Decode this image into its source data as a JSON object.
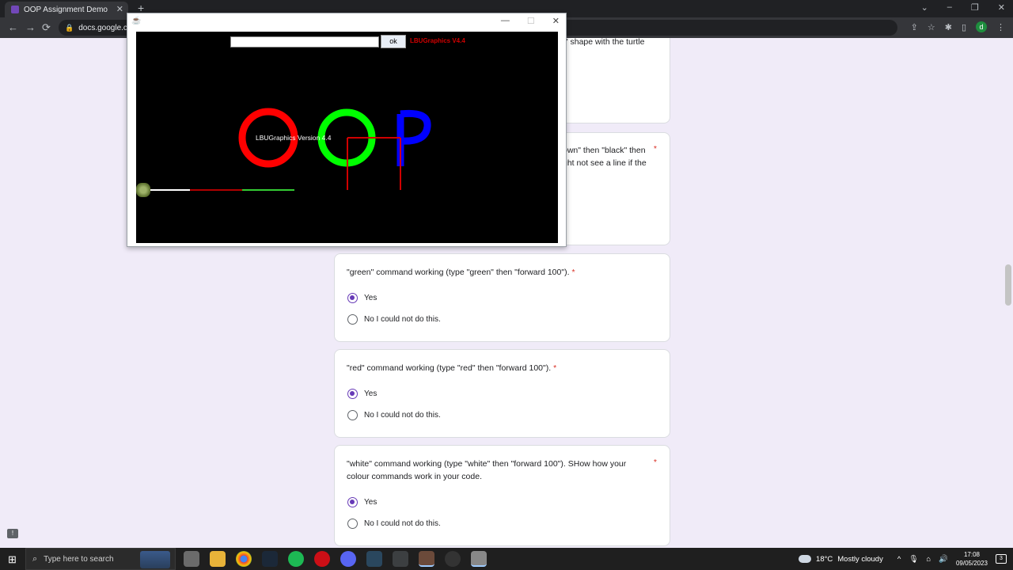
{
  "browser": {
    "tab_title": "OOP Assignment Demo",
    "tab_close": "✕",
    "new_tab": "+",
    "url": "docs.google.com",
    "lock": "🔒",
    "back": "←",
    "forward": "→",
    "reload": "⟳",
    "window_min": "⌄",
    "window_minimize": "–",
    "window_restore": "❐",
    "window_close": "✕",
    "profile_initial": "d",
    "toolbar_icons": [
      "share-icon",
      "star-icon",
      "extensions-icon",
      "sidepanel-icon"
    ]
  },
  "form": {
    "partial_top_text": "h\" shape with the turtle",
    "partial_mid_text_1": "own\" then \"black\" then",
    "partial_mid_text_2": "ght not see a line if the",
    "required_marker": "*",
    "questions": [
      {
        "title": "\"green\" command working (type \"green\" then \"forward 100\").",
        "options": [
          "Yes",
          "No I could not do this."
        ],
        "selected": 0
      },
      {
        "title": "\"red\" command working (type \"red\" then \"forward 100\").",
        "options": [
          "Yes",
          "No I could not do this."
        ],
        "selected": 0
      },
      {
        "title_line1": "\"white\" command working (type \"white\" then \"forward 100\"). SHow how your",
        "title_line2": "colour commands work in your code.",
        "options": [
          "Yes",
          "No I could not do this."
        ],
        "selected": 0
      }
    ],
    "feedback_icon": "!"
  },
  "java_window": {
    "title_icon": "java-cup-icon",
    "minimize": "—",
    "maximize": "☐",
    "close": "✕",
    "command_input_value": "",
    "ok_button": "ok",
    "version_label": "LBUGraphics V4.4",
    "canvas_label": "LBUGraphics Version 4.4",
    "colors": {
      "red": "#ff0000",
      "green": "#00ff00",
      "blue": "#0000ff",
      "white": "#ffffff",
      "darkred": "#b00000",
      "green_line": "#33cc33"
    }
  },
  "taskbar": {
    "start_icon": "⊞",
    "search_icon": "⌕",
    "search_placeholder": "Type here to search",
    "weather_temp": "18°C",
    "weather_desc": "Mostly cloudy",
    "time": "17:08",
    "date": "09/05/2023",
    "notification_count": "3",
    "tray_chevron": "^",
    "apps": [
      "task-view",
      "file-explorer",
      "chrome",
      "steam",
      "spotify",
      "opera",
      "discord",
      "steam-2",
      "ide",
      "settings",
      "obs",
      "java"
    ]
  }
}
